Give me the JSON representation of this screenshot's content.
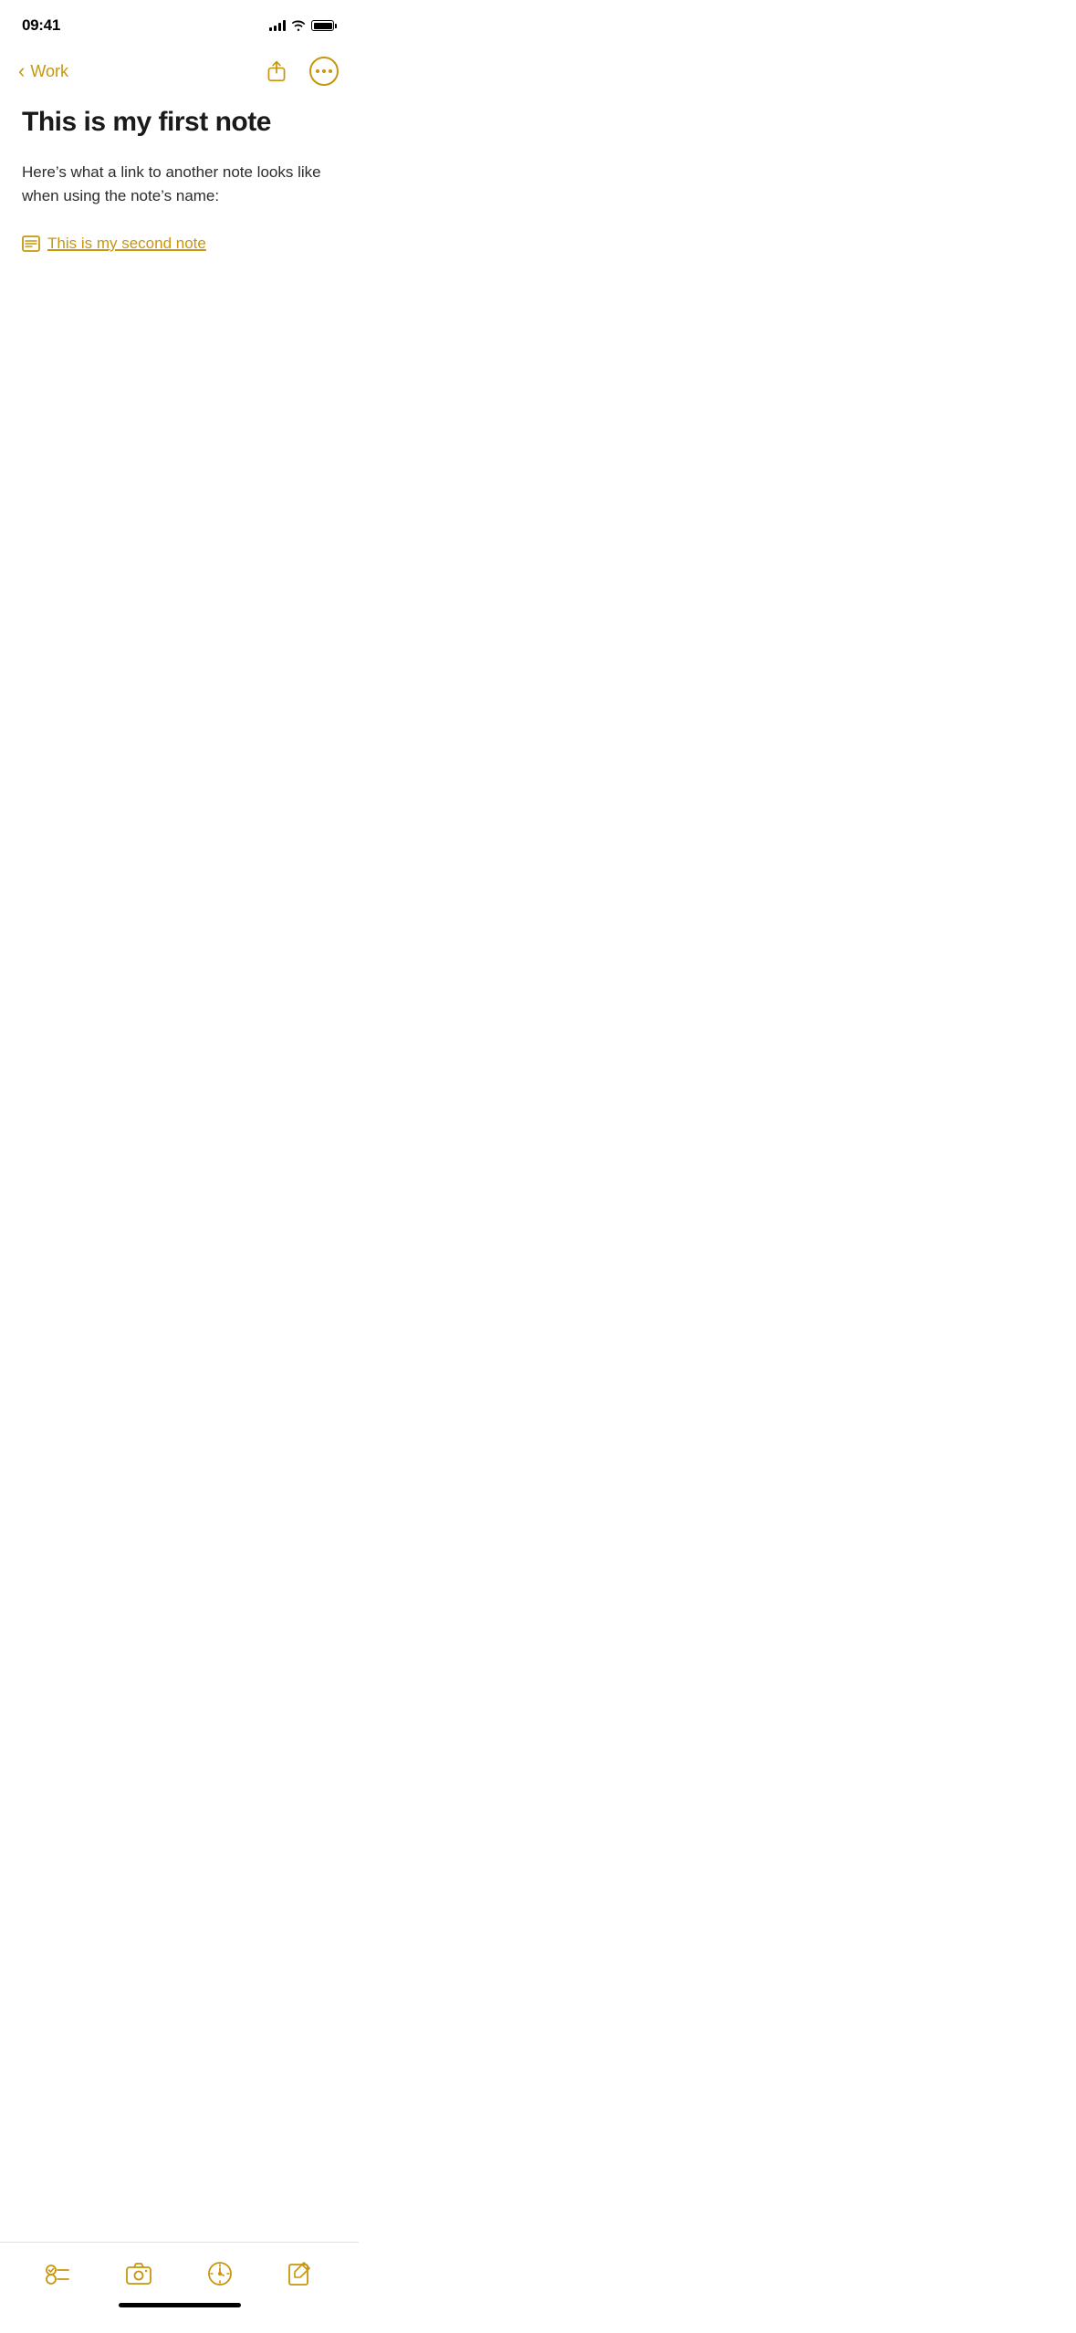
{
  "status_bar": {
    "time": "09:41",
    "signal_bars": 4,
    "wifi": true,
    "battery": "full"
  },
  "nav": {
    "back_label": "Work",
    "share_tooltip": "Share",
    "more_tooltip": "More options"
  },
  "note": {
    "title": "This is my first note",
    "body": "Here’s what a link to another note looks like when using the note’s name:",
    "link_text": "This is my second note"
  },
  "toolbar": {
    "checklist_label": "Checklist",
    "camera_label": "Camera",
    "pencil_label": "Markup",
    "compose_label": "New Note"
  },
  "colors": {
    "accent": "#c8960c",
    "text_primary": "#1a1a1a",
    "text_body": "#2c2c2c",
    "background": "#ffffff"
  }
}
